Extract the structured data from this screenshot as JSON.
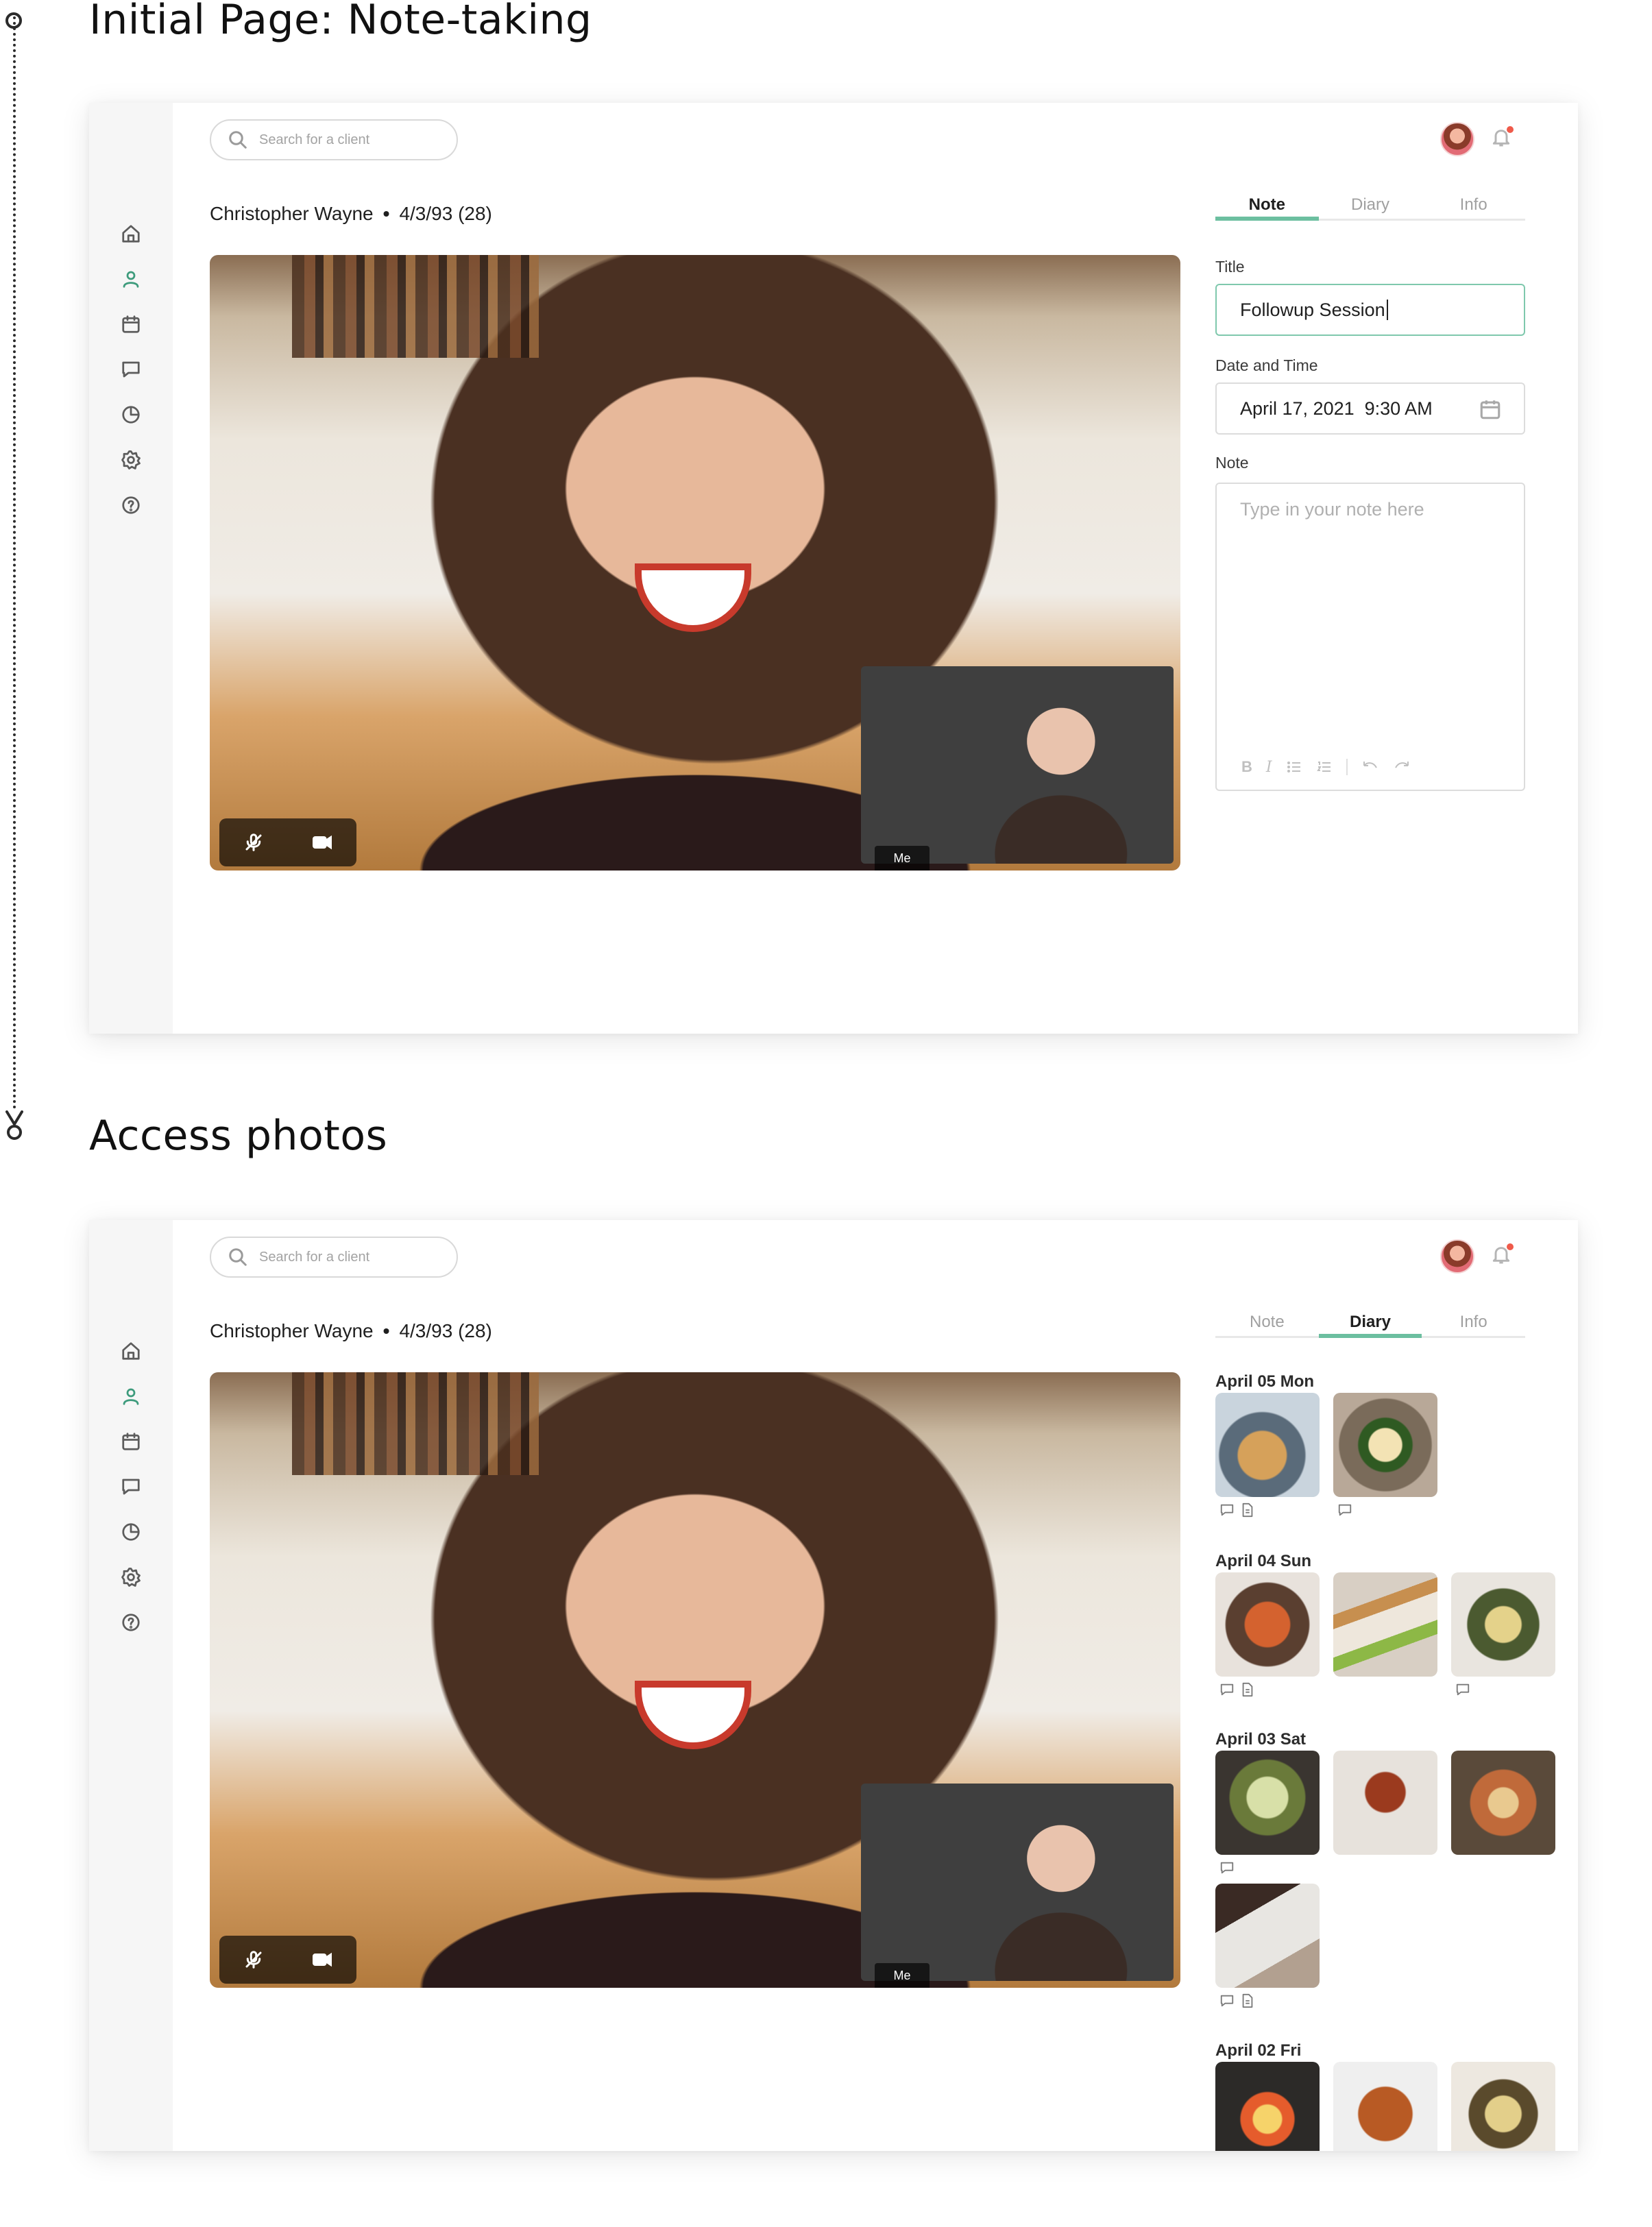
{
  "sections": {
    "first_title": "Initial Page: Note-taking",
    "second_title": "Access photos"
  },
  "app": {
    "search_placeholder": "Search for a client",
    "client_name": "Christopher Wayne",
    "separator": "•",
    "client_dob": "4/3/93 (28)",
    "pip_label": "Me",
    "sidebar": [
      "home-icon",
      "user-icon",
      "calendar-icon",
      "chat-icon",
      "pie-chart-icon",
      "gear-icon",
      "help-icon"
    ],
    "tabs": [
      "Note",
      "Diary",
      "Info"
    ]
  },
  "note_form": {
    "title_label": "Title",
    "title_value": "Followup Session",
    "datetime_label": "Date and Time",
    "datetime_value": "April 17, 2021  9:30 AM",
    "note_label": "Note",
    "note_placeholder": "Type in your note here",
    "toolbar": [
      "B",
      "I",
      "bullet-list-icon",
      "numbered-list-icon",
      "undo-icon",
      "redo-icon"
    ]
  },
  "diary": {
    "days": [
      {
        "label": "April 05 Mon",
        "photos": 2
      },
      {
        "label": "April 04 Sun",
        "photos": 3
      },
      {
        "label": "April 03 Sat",
        "photos": 4
      },
      {
        "label": "April 02 Fri",
        "photos": 3
      }
    ]
  },
  "colors": {
    "accent": "#6cbfa0",
    "active_icon": "#3d9b7c",
    "notification": "#ef5a4a",
    "sidebar_bg": "#f6f6f6"
  }
}
